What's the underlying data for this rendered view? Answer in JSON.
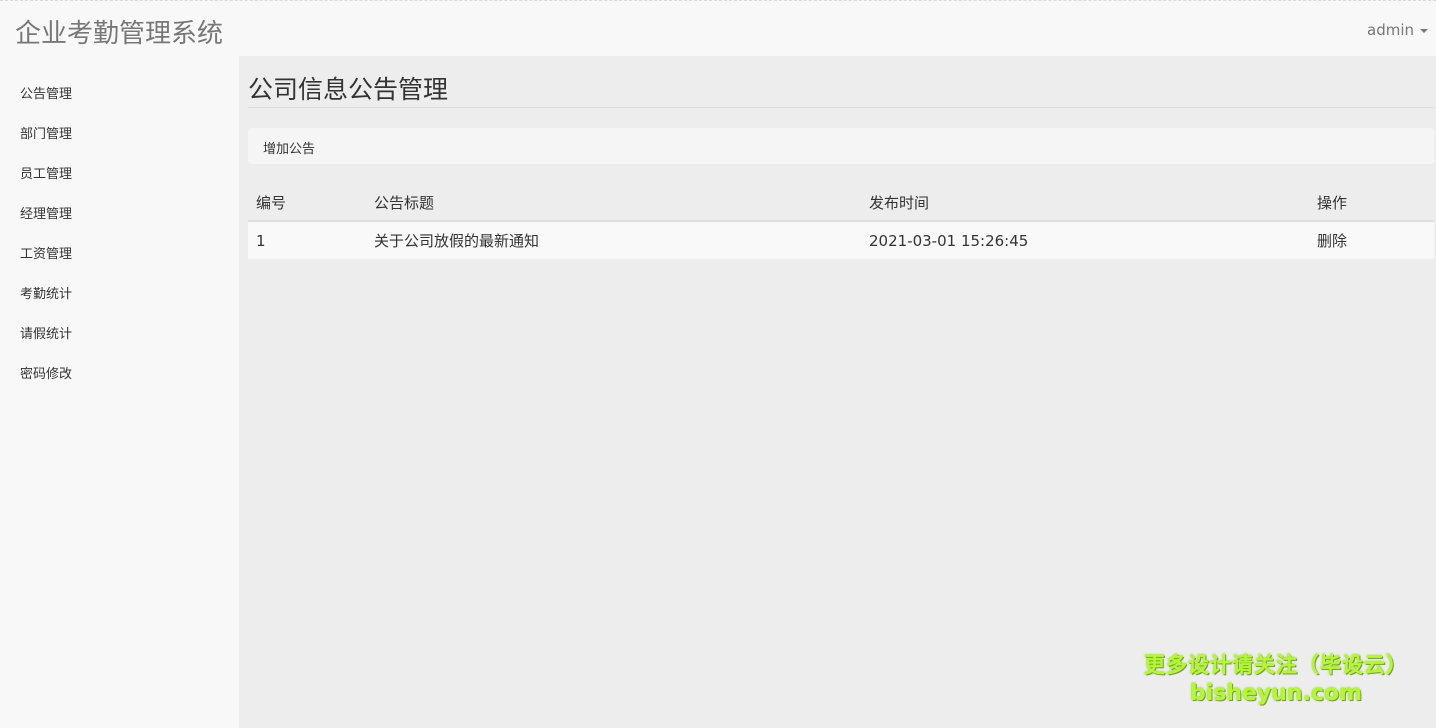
{
  "header": {
    "brand": "企业考勤管理系统",
    "user": "admin"
  },
  "sidebar": {
    "items": [
      {
        "label": "公告管理"
      },
      {
        "label": "部门管理"
      },
      {
        "label": "员工管理"
      },
      {
        "label": "经理管理"
      },
      {
        "label": "工资管理"
      },
      {
        "label": "考勤统计"
      },
      {
        "label": "请假统计"
      },
      {
        "label": "密码修改"
      }
    ]
  },
  "main": {
    "title": "公司信息公告管理",
    "add_label": "增加公告",
    "table": {
      "headers": [
        "编号",
        "公告标题",
        "发布时间",
        "操作"
      ],
      "rows": [
        {
          "id": "1",
          "title": "关于公司放假的最新通知",
          "time": "2021-03-01 15:26:45",
          "action": "删除"
        }
      ]
    }
  },
  "watermark": {
    "line1": "更多设计请关注（毕设云）",
    "line2": "bisheyun.com"
  }
}
